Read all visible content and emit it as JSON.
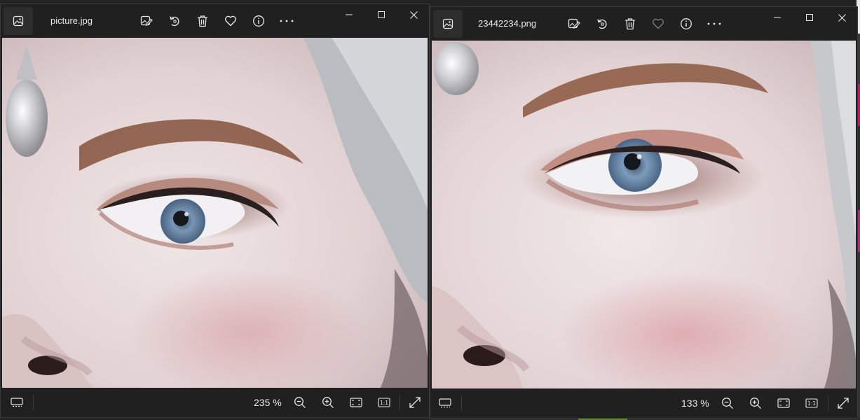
{
  "windows": [
    {
      "file_name": "picture.jpg",
      "zoom": "235 %",
      "favorite_filled": false,
      "toolbar": [
        "edit-image-icon",
        "rotate-icon",
        "delete-icon",
        "favorite-icon",
        "info-icon",
        "more-icon"
      ],
      "status": [
        "filmstrip-icon",
        "zoom-out-icon",
        "zoom-in-icon",
        "fit-to-window-icon",
        "actual-size-icon",
        "fullscreen-icon"
      ],
      "actual_size_label": "1:1"
    },
    {
      "file_name": "23442234.png",
      "zoom": "133 %",
      "favorite_filled": false,
      "toolbar": [
        "edit-image-icon",
        "rotate-icon",
        "delete-icon",
        "favorite-icon",
        "info-icon",
        "more-icon"
      ],
      "status": [
        "filmstrip-icon",
        "zoom-out-icon",
        "zoom-in-icon",
        "fit-to-window-icon",
        "actual-size-icon",
        "fullscreen-icon"
      ],
      "actual_size_label": "1:1"
    }
  ],
  "colors": {
    "chrome_bg": "#202020",
    "icon_fg": "#e6e6e6",
    "skin": "#e9dfe0",
    "iris": "#6f8fb0",
    "brow": "#8a5a45",
    "hair": "#b9bcc0"
  }
}
